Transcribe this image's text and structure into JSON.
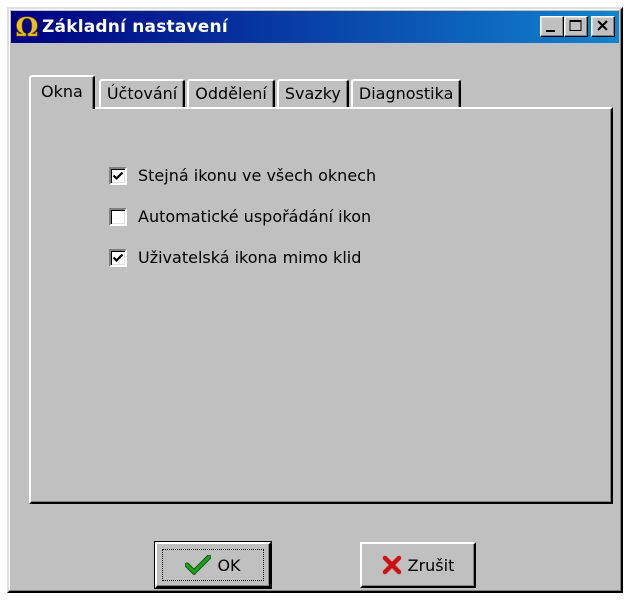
{
  "window": {
    "title": "Základní nastavení"
  },
  "title_buttons": {
    "minimize_icon": "minimize-icon",
    "maximize_icon": "maximize-icon",
    "close_icon": "close-icon"
  },
  "tabs": [
    {
      "label": "Okna",
      "active": true
    },
    {
      "label": "Účtování",
      "active": false
    },
    {
      "label": "Oddělení",
      "active": false
    },
    {
      "label": "Svazky",
      "active": false
    },
    {
      "label": "Diagnostika",
      "active": false
    }
  ],
  "options": [
    {
      "label": "Stejná ikonu ve všech oknech",
      "checked": true
    },
    {
      "label": "Automatické uspořádání ikon",
      "checked": false
    },
    {
      "label": "Uživatelská ikona mimo klid",
      "checked": true
    }
  ],
  "buttons": {
    "ok_label": "OK",
    "cancel_label": "Zrušit"
  },
  "colors": {
    "title_start": "#000080",
    "title_end": "#1084d0",
    "omega_icon": "#f0c020",
    "ok_check": "#20a020",
    "cancel_x": "#d01010"
  }
}
